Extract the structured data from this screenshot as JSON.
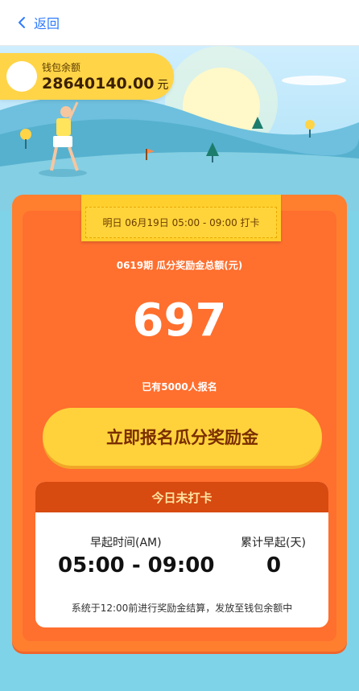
{
  "nav": {
    "back_label": "返回"
  },
  "wallet": {
    "label": "钱包余额",
    "amount": "28640140.00",
    "unit": "元"
  },
  "ribbon": {
    "text": "明日 06月19日 05:00 - 09:00 打卡"
  },
  "pool": {
    "period_label": "0619期 瓜分奖励金总额(元)",
    "total": "697",
    "enrolled_text": "已有5000人报名"
  },
  "join_button": {
    "label": "立即报名瓜分奖励金"
  },
  "status": {
    "header": "今日未打卡",
    "time_label": "早起时间(AM)",
    "time_value": "05:00 - 09:00",
    "days_label": "累计早起(天)",
    "days_value": "0",
    "note": "系统于12:00前进行奖励金结算，发放至钱包余额中"
  },
  "colors": {
    "accent": "#2f7bff",
    "card": "#ff6f2e",
    "button": "#ffd23b",
    "header": "#d74a10"
  }
}
